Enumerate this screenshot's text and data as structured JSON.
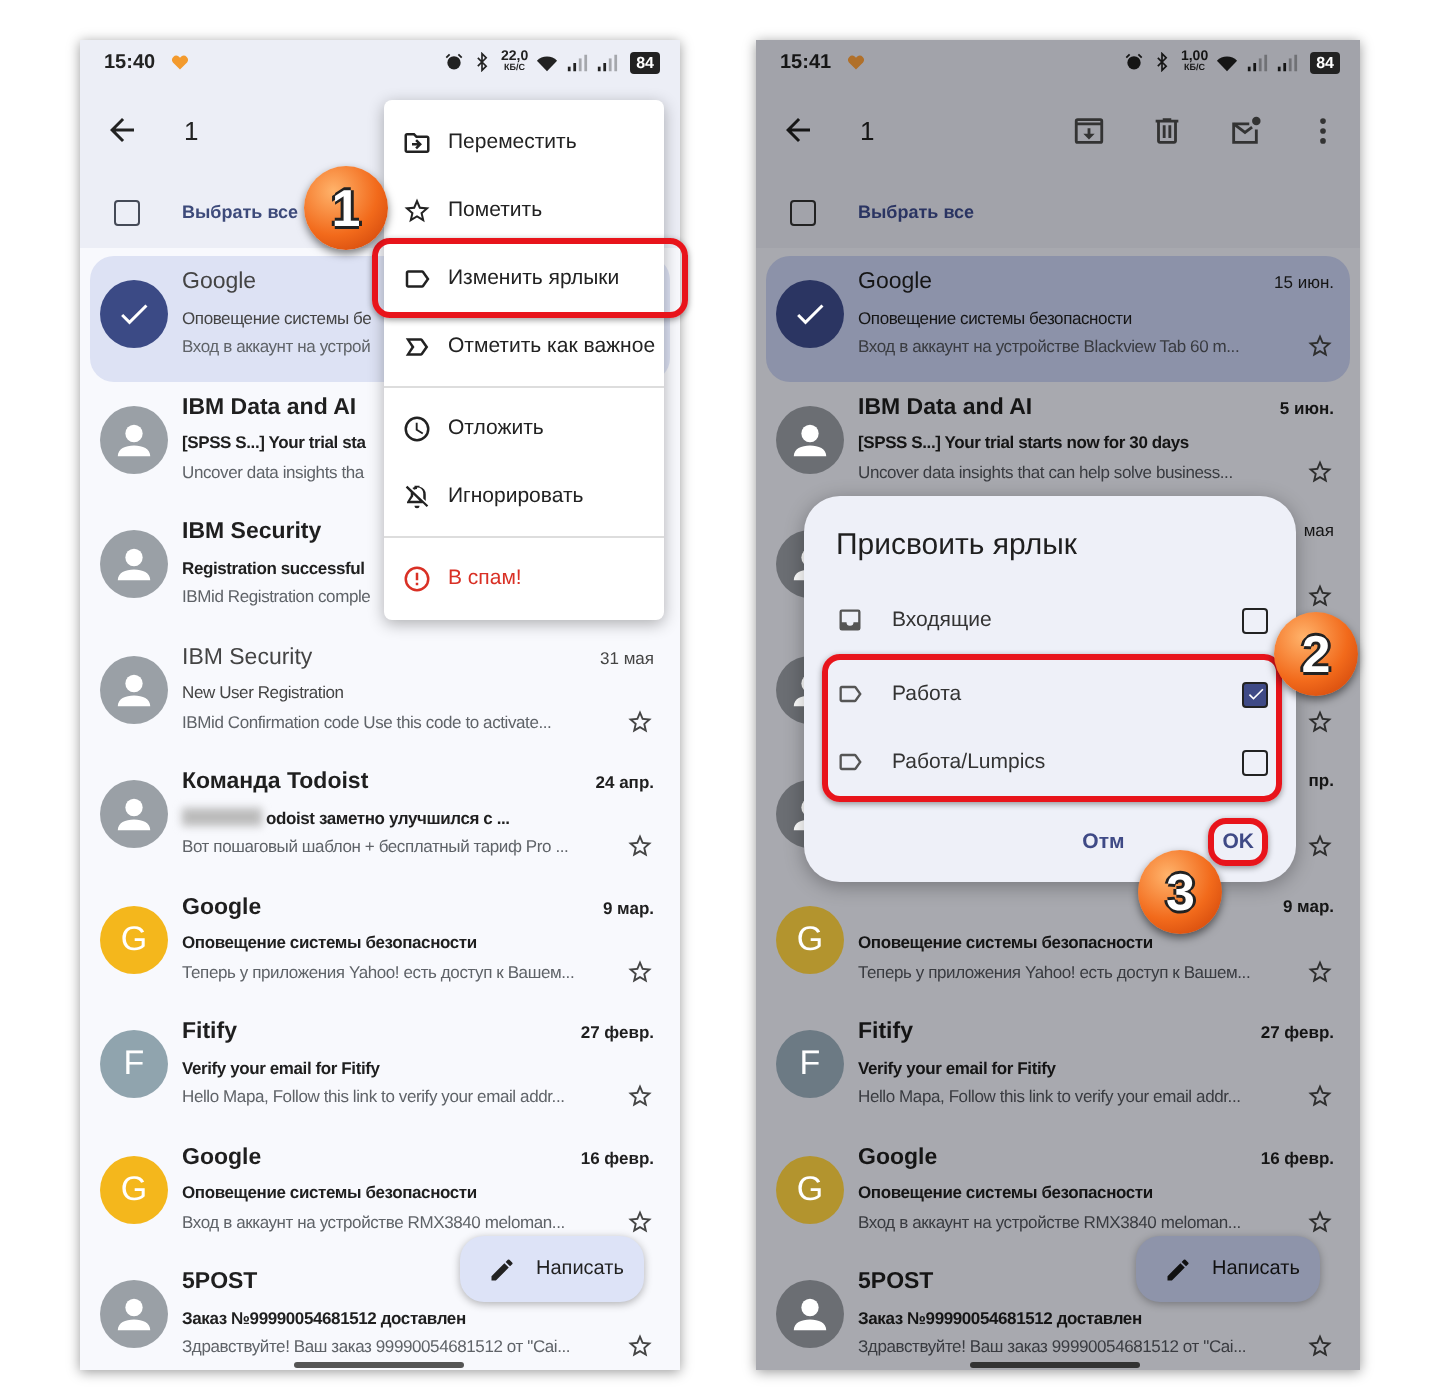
{
  "phones": [
    {
      "dimmed": false,
      "status_bar": {
        "time": "15:40",
        "speed": "22,0",
        "speed_unit": "КБ/С",
        "battery": "84"
      },
      "app_bar": {
        "count": "1"
      },
      "select_all": {
        "label": "Выбрать все",
        "checked": false
      },
      "emails": [
        {
          "avatar": {
            "kind": "check"
          },
          "selected": true,
          "unread": false,
          "sender": "Google",
          "subject": "Оповещение системы бе",
          "preview": "Вход в аккаунт на устрой"
        },
        {
          "avatar": {
            "kind": "person"
          },
          "selected": false,
          "unread": true,
          "sender": "IBM Data and AI",
          "subject": "[SPSS S...] Your trial sta",
          "preview": "Uncover data insights tha"
        },
        {
          "avatar": {
            "kind": "person"
          },
          "selected": false,
          "unread": true,
          "sender": "IBM Security",
          "subject": "Registration successful",
          "preview": "IBMid Registration comple"
        },
        {
          "avatar": {
            "kind": "person"
          },
          "selected": false,
          "unread": false,
          "sender": "IBM Security",
          "date": "31 мая",
          "subject": "New User Registration",
          "preview": "IBMid Confirmation code Use this code to activate...",
          "starred": false
        },
        {
          "avatar": {
            "kind": "person"
          },
          "selected": false,
          "unread": true,
          "sender": "Команда Todoist",
          "date": "24 апр.",
          "redacted": true,
          "subject": "odoist заметно улучшился с ...",
          "preview": "Вот пошаговый шаблон + бесплатный тариф Pro ...",
          "starred": false
        },
        {
          "avatar": {
            "kind": "letter",
            "letter": "G",
            "color": "#f4b71c"
          },
          "selected": false,
          "unread": true,
          "sender": "Google",
          "date": "9 мар.",
          "subject": "Оповещение системы безопасности",
          "preview": "Теперь у приложения Yahoo! есть доступ к Вашем...",
          "starred": false
        },
        {
          "avatar": {
            "kind": "letter",
            "letter": "F",
            "color": "#90a4ae"
          },
          "selected": false,
          "unread": true,
          "sender": "Fitify",
          "date": "27 февр.",
          "subject": "Verify your email for Fitify",
          "preview": "Hello Mapa, Follow this link to verify your email addr...",
          "starred": false
        },
        {
          "avatar": {
            "kind": "letter",
            "letter": "G",
            "color": "#f4b71c"
          },
          "selected": false,
          "unread": true,
          "sender": "Google",
          "date": "16 февр.",
          "subject": "Оповещение системы безопасности",
          "preview": "Вход в аккаунт на устройстве RMX3840 meloman...",
          "starred": false
        },
        {
          "avatar": {
            "kind": "person"
          },
          "selected": false,
          "unread": true,
          "sender": "5POST",
          "subject": "Заказ №99990054681512 доставлен",
          "preview": "Здравствуйте! Ваш заказ 99990054681512 от \"Cai...",
          "starred": false
        }
      ],
      "compose": {
        "label": "Написать"
      },
      "menu": {
        "sections": [
          {
            "items": [
              {
                "kind": "move",
                "label": "Переместить",
                "highlighted": false
              },
              {
                "kind": "star",
                "label": "Пометить",
                "highlighted": false
              },
              {
                "kind": "label",
                "label": "Изменить ярлыки",
                "highlighted": true,
                "step": "1"
              },
              {
                "kind": "important",
                "label": "Отметить как важное",
                "highlighted": false
              }
            ]
          },
          {
            "items": [
              {
                "kind": "snooze",
                "label": "Отложить",
                "highlighted": false
              },
              {
                "kind": "mute",
                "label": "Игнорировать",
                "highlighted": false
              }
            ]
          },
          {
            "items": [
              {
                "kind": "spam",
                "label": "В спам!",
                "highlighted": false
              }
            ]
          }
        ]
      }
    },
    {
      "dimmed": true,
      "status_bar": {
        "time": "15:41",
        "speed": "1,00",
        "speed_unit": "КБ/С",
        "battery": "84"
      },
      "app_bar": {
        "count": "1",
        "actions": [
          {
            "kind": "archive"
          },
          {
            "kind": "delete"
          },
          {
            "kind": "mark-unread"
          },
          {
            "kind": "more"
          }
        ]
      },
      "select_all": {
        "label": "Выбрать все",
        "checked": false
      },
      "emails": [
        {
          "avatar": {
            "kind": "check"
          },
          "selected": true,
          "unread": false,
          "sender": "Google",
          "date": "15 июн.",
          "subject": "Оповещение системы безопасности",
          "preview": "Вход в аккаунт на устройстве Blackview Tab 60 m...",
          "starred": false
        },
        {
          "avatar": {
            "kind": "person"
          },
          "selected": false,
          "unread": true,
          "sender": "IBM Data and AI",
          "date": "5 июн.",
          "subject": "[SPSS S...] Your trial starts now for 30 days",
          "preview": "Uncover data insights that can help solve business...",
          "starred": false
        },
        {
          "avatar": {
            "kind": "person"
          },
          "selected": false,
          "date": "мая",
          "starred": false
        },
        {
          "avatar": {
            "kind": "person"
          },
          "selected": false,
          "starred": false
        },
        {
          "avatar": {
            "kind": "person"
          },
          "selected": false,
          "unread": true,
          "date": "пр.",
          "starred": false
        },
        {
          "avatar": {
            "kind": "letter",
            "letter": "G",
            "color": "#b3942e"
          },
          "selected": false,
          "unread": true,
          "date": "9 мар.",
          "subject": "Оповещение системы безопасности",
          "preview": "Теперь у приложения Yahoo! есть доступ к Вашем...",
          "starred": false
        },
        {
          "avatar": {
            "kind": "letter",
            "letter": "F",
            "color": "#6c7a84"
          },
          "selected": false,
          "unread": true,
          "sender": "Fitify",
          "date": "27 февр.",
          "subject": "Verify your email for Fitify",
          "preview": "Hello Mapa, Follow this link to verify your email addr...",
          "starred": false
        },
        {
          "avatar": {
            "kind": "letter",
            "letter": "G",
            "color": "#b3942e"
          },
          "selected": false,
          "unread": true,
          "sender": "Google",
          "date": "16 февр.",
          "subject": "Оповещение системы безопасности",
          "preview": "Вход в аккаунт на устройстве RMX3840 meloman...",
          "starred": false
        },
        {
          "avatar": {
            "kind": "person"
          },
          "selected": false,
          "unread": true,
          "sender": "5POST",
          "subject": "Заказ №99990054681512 доставлен",
          "preview": "Здравствуйте! Ваш заказ 99990054681512 от \"Cai...",
          "starred": false
        }
      ],
      "compose": {
        "label": "Написать"
      },
      "dialog": {
        "title": "Присвоить ярлык",
        "highlight_step": "2",
        "options": [
          {
            "kind": "inbox",
            "label": "Входящие",
            "checked": false,
            "highlighted": false
          },
          {
            "kind": "label",
            "label": "Работа",
            "checked": true,
            "highlighted": true
          },
          {
            "kind": "label",
            "label": "Работа/Lumpics",
            "checked": false,
            "highlighted": true
          }
        ],
        "buttons": [
          {
            "label": "Отм",
            "highlighted": false
          },
          {
            "label": "OK",
            "highlighted": true,
            "step": "3"
          }
        ]
      }
    }
  ]
}
